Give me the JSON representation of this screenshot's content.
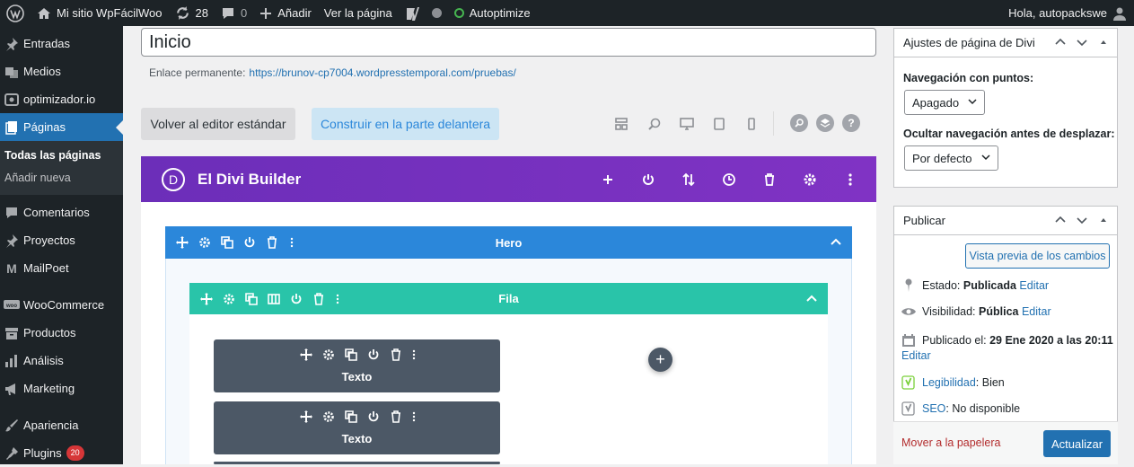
{
  "adminbar": {
    "site_name": "Mi sitio WpFácilWoo",
    "updates_count": "28",
    "comments_count": "0",
    "add_new": "Añadir",
    "view_page": "Ver la página",
    "autoptimize": "Autoptimize",
    "greeting": "Hola, autopackswe"
  },
  "sidebar": {
    "items": [
      {
        "label": "Entradas"
      },
      {
        "label": "Medios"
      },
      {
        "label": "optimizador.io"
      },
      {
        "label": "Páginas"
      },
      {
        "label": "Comentarios"
      },
      {
        "label": "Proyectos"
      },
      {
        "label": "MailPoet"
      },
      {
        "label": "WooCommerce"
      },
      {
        "label": "Productos"
      },
      {
        "label": "Análisis"
      },
      {
        "label": "Marketing"
      },
      {
        "label": "Apariencia"
      },
      {
        "label": "Plugins",
        "badge": "20"
      }
    ],
    "subitems": [
      "Todas las páginas",
      "Añadir nueva"
    ]
  },
  "editor": {
    "title_value": "Inicio",
    "permalink_label": "Enlace permanente:",
    "permalink_url": "https://brunov-cp7004.wordpresstemporal.com/pruebas/",
    "btn_standard": "Volver al editor estándar",
    "btn_frontend": "Construir en la parte delantera"
  },
  "divi": {
    "title": "El Divi Builder",
    "logo_letter": "D",
    "section_label": "Hero",
    "row_label": "Fila",
    "modules": [
      "Texto",
      "Texto"
    ],
    "add_symbol": "+"
  },
  "settings_box": {
    "title": "Ajustes de página de Divi",
    "dots_label": "Navegación con puntos:",
    "dots_value": "Apagado",
    "hide_nav_label": "Ocultar navegación antes de desplazar:",
    "hide_nav_value": "Por defecto"
  },
  "publish_box": {
    "title": "Publicar",
    "preview_btn": "Vista previa de los cambios",
    "status_label": "Estado:",
    "status_value": "Publicada",
    "visibility_label": "Visibilidad:",
    "visibility_value": "Pública",
    "published_label": "Publicado el:",
    "published_value": "29 Ene 2020 a las 20:11",
    "edit": "Editar",
    "readability_link": "Legibilidad",
    "readability_value": ": Bien",
    "seo_link": "SEO",
    "seo_value": ": No disponible",
    "trash": "Mover a la papelera",
    "update": "Actualizar"
  },
  "colors": {
    "divi_purple": "#7b35bf",
    "section_blue": "#2b87da",
    "row_teal": "#29c4a9",
    "module_gray": "#4c5866",
    "wp_blue": "#2271b1"
  }
}
